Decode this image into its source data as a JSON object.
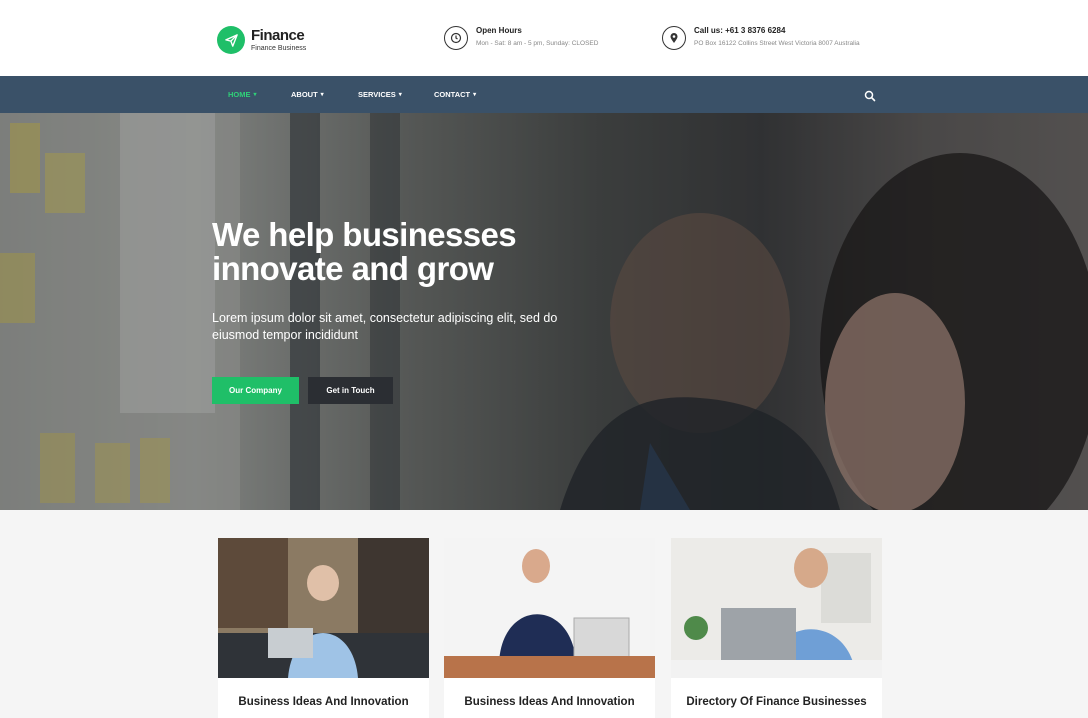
{
  "brand": {
    "name": "Finance",
    "tagline": "Finance Business",
    "accent": "#1fbf68"
  },
  "contact_info": [
    {
      "icon": "clock-icon",
      "title": "Open Hours",
      "detail": "Mon - Sat: 8 am - 5 pm, Sunday: CLOSED"
    },
    {
      "icon": "map-pin-icon",
      "title": "Call us: +61 3 8376 6284",
      "detail": "PO Box 16122 Collins Street West Victoria 8007 Australia"
    }
  ],
  "nav": {
    "background": "#3a5168",
    "items": [
      {
        "label": "HOME",
        "active": true
      },
      {
        "label": "ABOUT",
        "active": false
      },
      {
        "label": "SERVICES",
        "active": false
      },
      {
        "label": "CONTACT",
        "active": false
      }
    ],
    "search_icon": "search-icon"
  },
  "hero": {
    "title_line1": "We help businesses",
    "title_line2": "innovate and grow",
    "text": "Lorem ipsum dolor sit amet, consectetur adipiscing elit, sed do eiusmod tempor incididunt",
    "primary_button": "Our Company",
    "secondary_button": "Get in Touch"
  },
  "cards": [
    {
      "title": "Business Ideas And Innovation"
    },
    {
      "title": "Business Ideas And Innovation"
    },
    {
      "title": "Directory Of Finance Businesses"
    }
  ]
}
